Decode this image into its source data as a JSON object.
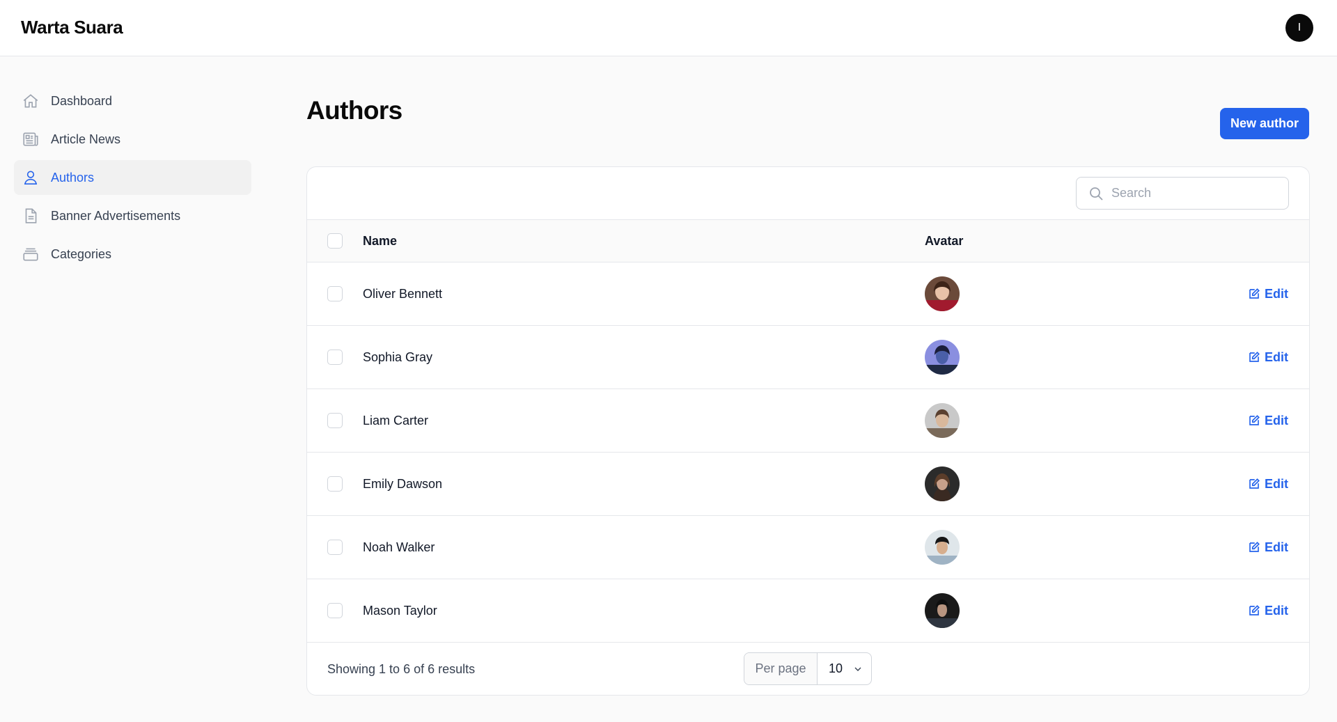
{
  "app": {
    "brand": "Warta Suara",
    "user_initial": "I"
  },
  "sidebar": {
    "items": [
      {
        "label": "Dashboard",
        "icon": "home-icon",
        "active": false
      },
      {
        "label": "Article News",
        "icon": "newspaper-icon",
        "active": false
      },
      {
        "label": "Authors",
        "icon": "user-icon",
        "active": true
      },
      {
        "label": "Banner Advertisements",
        "icon": "document-icon",
        "active": false
      },
      {
        "label": "Categories",
        "icon": "archive-box-icon",
        "active": false
      }
    ]
  },
  "page": {
    "title": "Authors",
    "new_button": "New author"
  },
  "search": {
    "placeholder": "Search",
    "value": ""
  },
  "table": {
    "headers": {
      "name": "Name",
      "avatar": "Avatar"
    },
    "rows": [
      {
        "name": "Oliver Bennett",
        "action": "Edit"
      },
      {
        "name": "Sophia Gray",
        "action": "Edit"
      },
      {
        "name": "Liam Carter",
        "action": "Edit"
      },
      {
        "name": "Emily Dawson",
        "action": "Edit"
      },
      {
        "name": "Noah Walker",
        "action": "Edit"
      },
      {
        "name": "Mason Taylor",
        "action": "Edit"
      }
    ]
  },
  "footer": {
    "showing": "Showing 1 to 6 of 6 results",
    "per_page_label": "Per page",
    "per_page_value": "10"
  },
  "colors": {
    "accent": "#2563eb",
    "text": "#111827",
    "border": "#e5e7eb"
  }
}
